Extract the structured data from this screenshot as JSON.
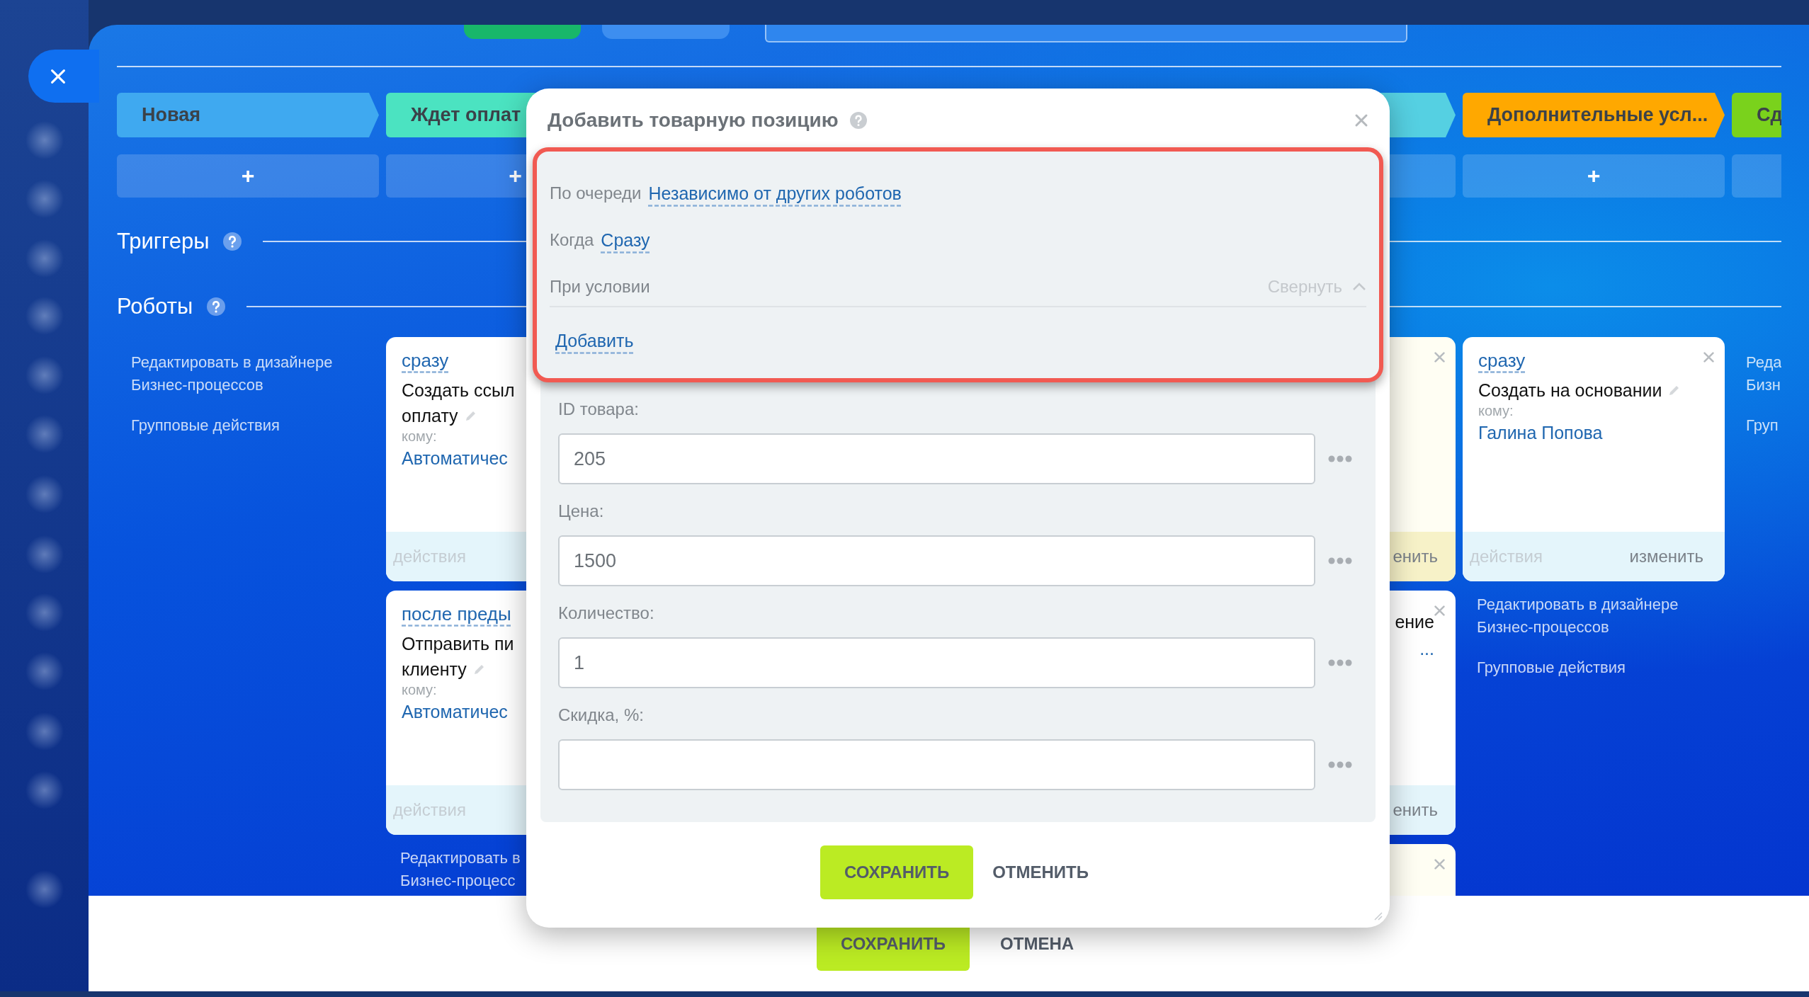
{
  "board": {
    "columns": [
      {
        "stage": {
          "label": "Новая",
          "color": "#3fa9f0"
        },
        "add_label": "+",
        "links": [
          {
            "lines": [
              "Редактировать в дизайнере",
              "Бизнес-процессов"
            ]
          },
          {
            "lines": [
              "Групповые действия"
            ]
          }
        ]
      },
      {
        "stage": {
          "label": "Ждет оплат",
          "color": "#4be3c1"
        },
        "add_label": "+",
        "cards": [
          {
            "kind": "white",
            "when": "сразу",
            "title_lines": [
              "Создать ссыл",
              "оплату"
            ],
            "editable": true,
            "to_label": "кому:",
            "recipient": "Автоматичес",
            "footer_left": "действия"
          },
          {
            "kind": "white",
            "when": "после преды",
            "title_lines": [
              "Отправить пи",
              "клиенту"
            ],
            "editable": true,
            "to_label": "кому:",
            "recipient": "Автоматичес",
            "footer_left": "действия"
          }
        ],
        "links": [
          {
            "lines": [
              "Редактировать в",
              "Бизнес-процесс"
            ]
          }
        ]
      },
      {
        "stage": {
          "color": "#55d0e2"
        },
        "cards": [
          {
            "kind": "yellow",
            "closable": true,
            "footer_right": "енить"
          },
          {
            "kind": "white",
            "closable": true,
            "title_lines": [
              "ение"
            ],
            "recipient": "...",
            "footer_right": "енить"
          },
          {
            "kind": "yellow",
            "closable": true
          }
        ]
      },
      {
        "stage": {
          "label": "Дополнительные усл...",
          "color": "#ffa800"
        },
        "add_label": "+",
        "cards": [
          {
            "kind": "white",
            "closable": true,
            "when": "сразу",
            "title_lines": [
              "Создать на основании"
            ],
            "editable": true,
            "to_label": "кому:",
            "recipient": "Галина Попова",
            "footer_left": "действия",
            "footer_right": "изменить"
          }
        ],
        "links": [
          {
            "lines": [
              "Редактировать в дизайнере",
              "Бизнес-процессов"
            ]
          },
          {
            "lines": [
              "Групповые действия"
            ]
          }
        ]
      },
      {
        "stage": {
          "label": "Сд",
          "color": "#7ad21c"
        },
        "links": [
          {
            "lines": [
              "Реда",
              "Бизн"
            ]
          },
          {
            "lines": [
              "Груп"
            ]
          }
        ]
      }
    ]
  },
  "sections": [
    {
      "title": "Триггеры"
    },
    {
      "title": "Роботы"
    }
  ],
  "dialog": {
    "title": "Добавить товарную позицию",
    "highlighted": true,
    "settings": {
      "order_label": "По очереди",
      "order_value": "Независимо от других роботов",
      "when_label": "Когда",
      "when_value": "Сразу",
      "condition_label": "При условии",
      "collapse_label": "Свернуть",
      "expanded": true,
      "add_label": "Добавить"
    },
    "fields": [
      {
        "label": "ID товара:",
        "value": "205"
      },
      {
        "label": "Цена:",
        "value": "1500"
      },
      {
        "label": "Количество:",
        "value": "1"
      },
      {
        "label": "Скидка, %:"
      }
    ],
    "buttons": [
      {
        "label": "СОХРАНИТЬ",
        "kind": "primary"
      },
      {
        "label": "ОТМЕНИТЬ",
        "kind": "link"
      }
    ]
  },
  "footer_buttons": [
    {
      "label": "СОХРАНИТЬ",
      "kind": "primary"
    },
    {
      "label": "ОТМЕНА",
      "kind": "link"
    }
  ]
}
